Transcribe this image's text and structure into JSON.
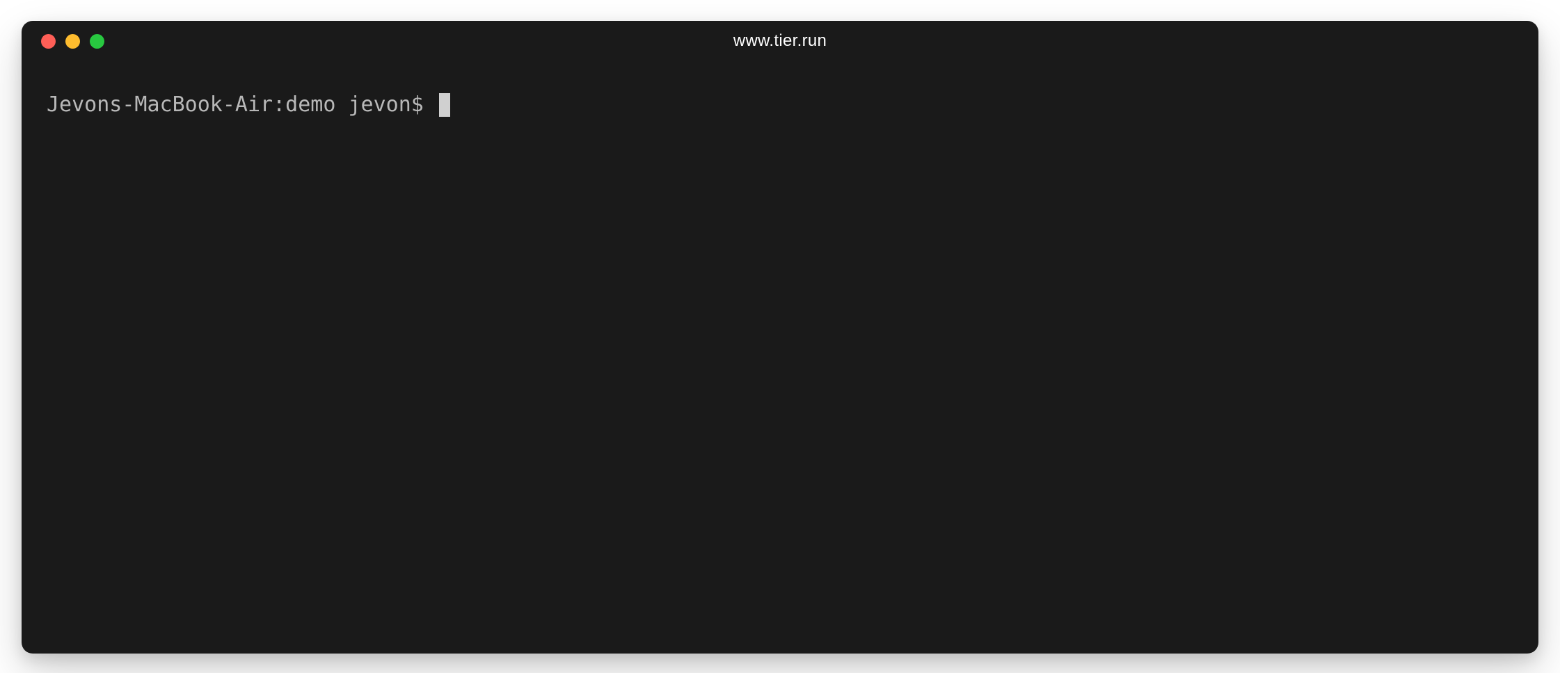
{
  "window": {
    "title": "www.tier.run"
  },
  "terminal": {
    "prompt": "Jevons-MacBook-Air:demo jevon$ ",
    "input": ""
  }
}
